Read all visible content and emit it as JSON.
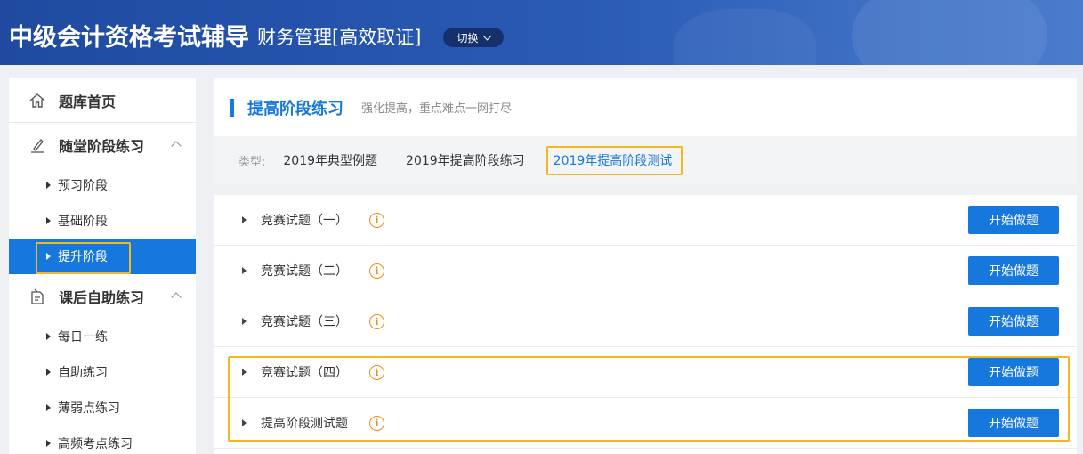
{
  "header": {
    "brand": "中级会计资格考试辅导",
    "subject": "财务管理[高效取证]",
    "switch_label": "切换"
  },
  "sidebar": {
    "home_label": "题库首页",
    "section1": {
      "title": "随堂阶段练习",
      "items": [
        {
          "label": "预习阶段"
        },
        {
          "label": "基础阶段"
        },
        {
          "label": "提升阶段"
        }
      ]
    },
    "section2": {
      "title": "课后自助练习",
      "items": [
        {
          "label": "每日一练"
        },
        {
          "label": "自助练习"
        },
        {
          "label": "薄弱点练习"
        },
        {
          "label": "高频考点练习"
        }
      ]
    },
    "active_item": "提升阶段"
  },
  "main": {
    "title": "提高阶段练习",
    "subtitle": "强化提高，重点难点一网打尽",
    "type_label": "类型:",
    "types": [
      {
        "label": "2019年典型例题"
      },
      {
        "label": "2019年提高阶段练习"
      },
      {
        "label": "2019年提高阶段测试"
      }
    ],
    "active_type": "2019年提高阶段测试",
    "rows": [
      {
        "name": "竞赛试题（一）",
        "button": "开始做题"
      },
      {
        "name": "竞赛试题（二）",
        "button": "开始做题"
      },
      {
        "name": "竞赛试题（三）",
        "button": "开始做题"
      },
      {
        "name": "竞赛试题（四）",
        "button": "开始做题"
      },
      {
        "name": "提高阶段测试题",
        "button": "开始做题"
      }
    ]
  },
  "colors": {
    "accent": "#1677dd",
    "header": "#2a5bb5",
    "highlight": "#f5b81c",
    "info": "#f08a1a"
  }
}
